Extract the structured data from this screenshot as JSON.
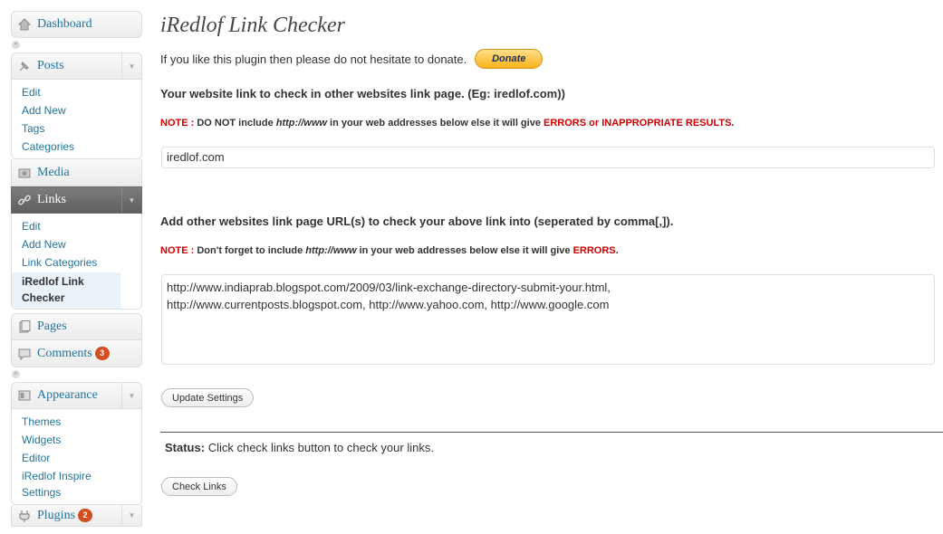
{
  "sidebar": {
    "dashboard": {
      "label": "Dashboard",
      "icon": "dashboard-icon"
    },
    "posts": {
      "label": "Posts",
      "icon": "pushpin-icon",
      "items": [
        "Edit",
        "Add New",
        "Tags",
        "Categories"
      ]
    },
    "media": {
      "label": "Media",
      "icon": "media-icon"
    },
    "links": {
      "label": "Links",
      "icon": "link-icon",
      "items": [
        "Edit",
        "Add New",
        "Link Categories",
        "iRedlof Link Checker"
      ]
    },
    "pages": {
      "label": "Pages",
      "icon": "pages-icon"
    },
    "comments": {
      "label": "Comments",
      "icon": "comment-icon",
      "count": "3"
    },
    "appearance": {
      "label": "Appearance",
      "icon": "appearance-icon",
      "items": [
        "Themes",
        "Widgets",
        "Editor",
        "iRedlof Inspire Settings"
      ]
    },
    "plugins": {
      "label": "Plugins",
      "icon": "plugin-icon",
      "count": "2"
    }
  },
  "main": {
    "title": "iRedlof Link Checker",
    "donate_text": "If you like this plugin then please do not hesitate to donate.",
    "donate_label": "Donate",
    "heading1": "Your website link to check in other websites link page. (Eg: iredlof.com))",
    "note_label": "NOTE :",
    "note1_text_a": "DO NOT include",
    "note1_code": "http://www",
    "note1_text_b": "in your web addresses below else it will give",
    "note1_red": "ERRORS or INAPPROPRIATE RESULTS",
    "note1_end": ".",
    "website_value": "iredlof.com",
    "heading2": "Add other websites link page URL(s) to check your above link into (seperated by comma[,]).",
    "note2_text_a": "Don't forget to include",
    "note2_code": "http://www",
    "note2_text_b": "in your web addresses below else it will give",
    "note2_red": "ERRORS",
    "note2_end": ".",
    "urls_line1": "http://www.indiaprab.blogspot.com/2009/03/link-exchange-directory-submit-your.html,",
    "urls_line2": "http://www.currentposts.blogspot.com, http://www.yahoo.com, http://www.google.com",
    "update_button": "Update Settings",
    "status_label": "Status:",
    "status_text": "Click check links button to check your links.",
    "check_button": "Check Links"
  },
  "colors": {
    "link": "#21759b",
    "error": "#cc0000",
    "badge": "#d54e21",
    "current_menu": "#6d6d6d"
  }
}
